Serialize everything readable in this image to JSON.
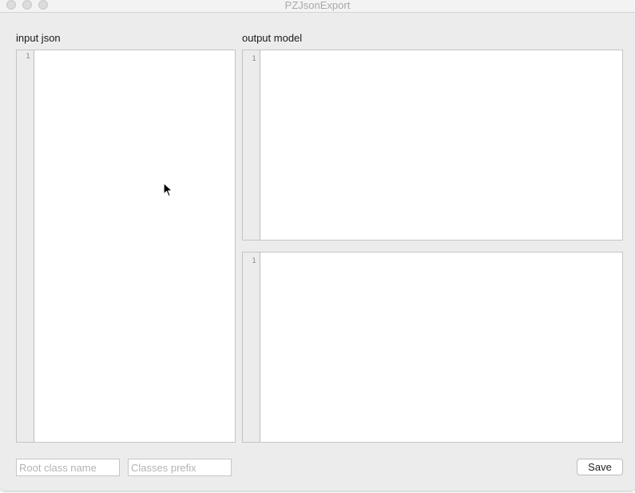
{
  "window": {
    "title": "PZJsonExport"
  },
  "input_panel": {
    "label": "input json",
    "line_numbers": [
      "1"
    ]
  },
  "output_panel": {
    "label": "output model",
    "top_editor": {
      "line_numbers": [
        "1"
      ]
    },
    "bottom_editor": {
      "line_numbers": [
        "1"
      ]
    }
  },
  "bottom_bar": {
    "root_class_field": {
      "value": "",
      "placeholder": "Root class name"
    },
    "prefix_field": {
      "value": "",
      "placeholder": "Classes prefix"
    },
    "save_label": "Save"
  },
  "icons": {
    "close": "close-icon",
    "minimize": "minimize-icon",
    "zoom": "zoom-icon",
    "cursor": "mouse-pointer-icon"
  },
  "colors": {
    "window_background": "#ececec",
    "editor_background": "#ffffff",
    "gutter_background": "#ececec",
    "title_text": "#a9a9a9"
  }
}
